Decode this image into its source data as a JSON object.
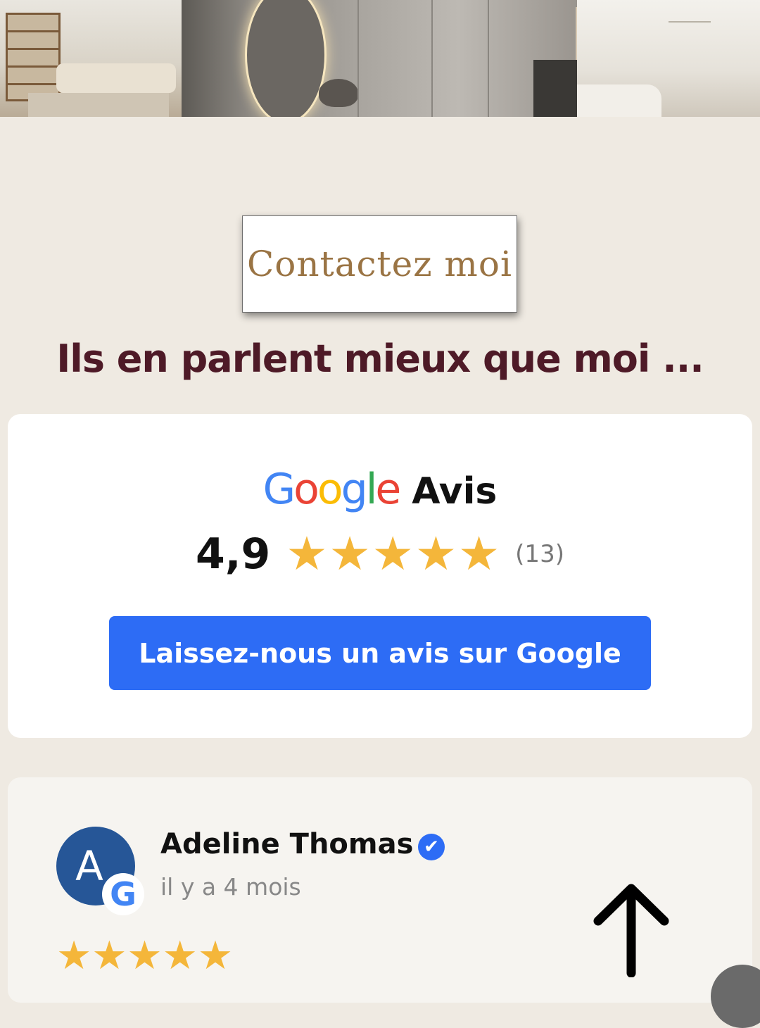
{
  "hero": {
    "photos": [
      "salon-photo",
      "entree-photo",
      "cuisine-photo"
    ]
  },
  "contact": {
    "label": "Contactez moi"
  },
  "section": {
    "heading": "Ils en parlent mieux que moi  ..."
  },
  "google_summary": {
    "logo_letters": [
      "G",
      "o",
      "o",
      "g",
      "l",
      "e"
    ],
    "title": "Avis",
    "score": "4,9",
    "stars": [
      "★",
      "★",
      "★",
      "★",
      "★"
    ],
    "count": "(13)",
    "button_label": "Laissez-nous un avis sur Google",
    "colors": {
      "button": "#2d6cf5",
      "star": "#f4b63a"
    }
  },
  "review": {
    "avatar_initial": "A",
    "badge_letter": "G",
    "name": "Adeline Thomas",
    "verified_icon": "✔",
    "date": "il y a 4 mois",
    "stars": [
      "★",
      "★",
      "★",
      "★",
      "★"
    ]
  },
  "colors": {
    "page_bg": "#efeae2",
    "heading": "#4e1a27",
    "contact_text": "#9a7444"
  }
}
